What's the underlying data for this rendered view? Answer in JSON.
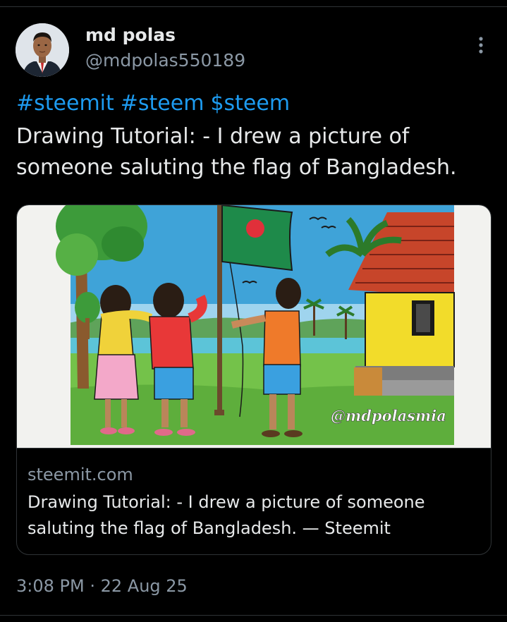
{
  "author": {
    "display_name": "md polas",
    "handle": "@mdpolas550189",
    "avatar_icon": "profile-photo"
  },
  "more_icon": "more-vertical-icon",
  "hashtags": [
    "#steemit",
    "#steem",
    "$steem"
  ],
  "tweet_text": "Drawing Tutorial: - I drew a picture of someone saluting the flag of Bangladesh.",
  "link_card": {
    "image_watermark": "@mdpolasmia",
    "domain": "steemit.com",
    "title": "Drawing Tutorial: - I drew a picture of someone saluting the flag of Bangladesh. — Steemit"
  },
  "timestamp": {
    "time": "3:08 PM",
    "separator": "·",
    "date": "22 Aug 25"
  },
  "colors": {
    "background": "#000000",
    "text_primary": "#e7e9ea",
    "text_secondary": "#8b98a5",
    "link": "#1d9bf0",
    "divider": "#2f3336",
    "flag_green": "#1e8a4a",
    "flag_red": "#e0303a"
  }
}
